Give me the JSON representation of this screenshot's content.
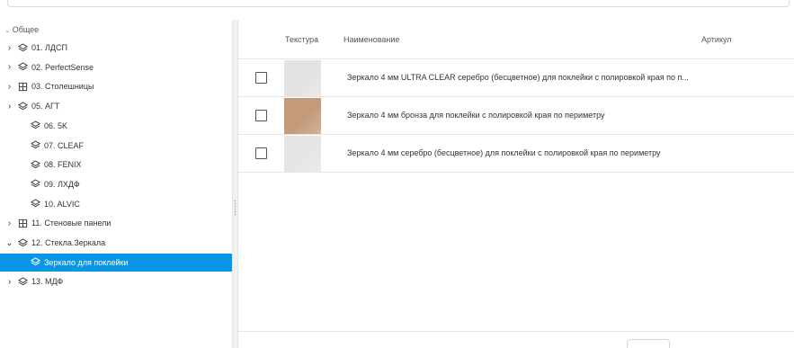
{
  "tree": {
    "root_label": "Общее",
    "items": [
      {
        "label": "01. ЛДСП",
        "toggle": "›",
        "icon": "layers-icon"
      },
      {
        "label": "02. PerfectSense",
        "toggle": "›",
        "icon": "layers-icon"
      },
      {
        "label": "03. Столешницы",
        "toggle": "›",
        "icon": "cabinet-icon"
      },
      {
        "label": "05. АГТ",
        "toggle": "›",
        "icon": "layers-icon"
      },
      {
        "label": "06. 5K",
        "toggle": "",
        "icon": "layers-icon"
      },
      {
        "label": "07. CLEAF",
        "toggle": "",
        "icon": "layers-icon"
      },
      {
        "label": "08. FENIX",
        "toggle": "",
        "icon": "layers-icon"
      },
      {
        "label": "09. ЛХДФ",
        "toggle": "",
        "icon": "layers-icon"
      },
      {
        "label": "10. ALVIC",
        "toggle": "",
        "icon": "layers-icon"
      },
      {
        "label": "11. Стеновые панели",
        "toggle": "›",
        "icon": "cabinet-icon"
      },
      {
        "label": "12. Стекла.Зеркала",
        "toggle": "⌄",
        "icon": "layers-icon"
      },
      {
        "label": "Зеркало для поклейки",
        "toggle": "",
        "icon": "layers-icon",
        "selected": true
      },
      {
        "label": "13. МДФ",
        "toggle": "›",
        "icon": "layers-icon"
      }
    ]
  },
  "grid": {
    "columns": {
      "texture": "Текстура",
      "name": "Наименование",
      "article": "Артикул"
    },
    "rows": [
      {
        "name": "Зеркало 4 мм ULTRA CLEAR серебро (бесцветное) для поклейки с полировкой края по п...",
        "swatch_color": "#e3e3e3",
        "checked": false
      },
      {
        "name": "Зеркало 4 мм бронза для поклейки с полировкой края по периметру",
        "swatch_color": "#c49a78",
        "checked": false
      },
      {
        "name": "Зеркало 4 мм серебро (бесцветное) для поклейки с полировкой края по периметру",
        "swatch_color": "#e5e5e5",
        "checked": false
      }
    ]
  },
  "colors": {
    "selection": "#0a96e6"
  }
}
